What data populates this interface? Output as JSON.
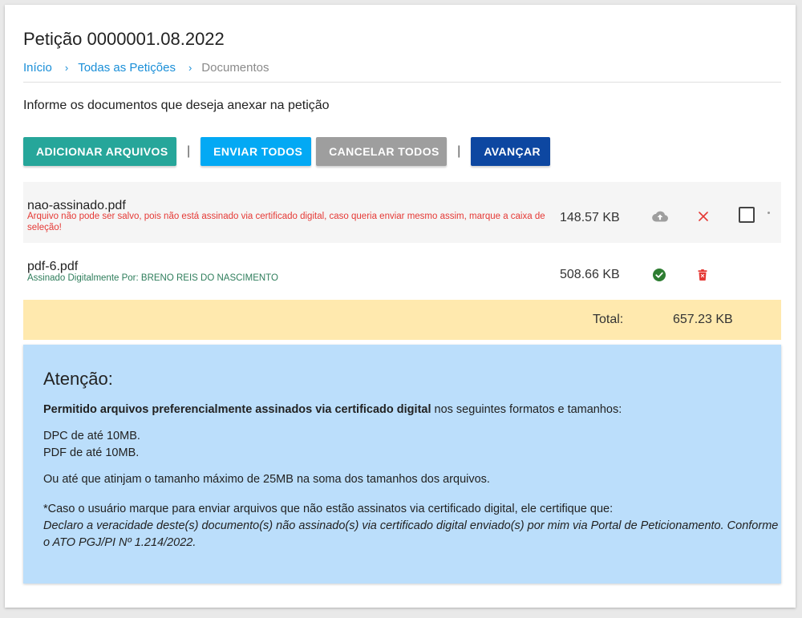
{
  "header": {
    "title": "Petição 0000001.08.2022",
    "breadcrumb": [
      {
        "label": "Início"
      },
      {
        "label": "Todas as Petições"
      },
      {
        "label": "Documentos"
      }
    ],
    "separator": "›"
  },
  "instructions": "Informe os documentos que deseja anexar na petição",
  "toolbar": {
    "add_label": "Adicionar arquivos",
    "send_all_label": "Enviar todos",
    "cancel_all_label": "Cancelar todos",
    "next_label": "Avançar",
    "divider": "|"
  },
  "files": [
    {
      "name": "nao-assinado.pdf",
      "message": "Arquivo não pode ser salvo, pois não está assinado via certificado digital, caso queria enviar mesmo assim, marque a caixa de seleção!",
      "size": "148.57 KB",
      "status_icon": "cloud-upload-icon",
      "action_icon": "close-icon",
      "checkbox_checked": false
    },
    {
      "name": "pdf-6.pdf",
      "message": "Assinado Digitalmente Por: BRENO REIS DO NASCIMENTO",
      "size": "508.66 KB",
      "status_icon": "check-circle-icon",
      "action_icon": "trash-icon"
    }
  ],
  "total": {
    "label": "Total:",
    "value": "657.23 KB"
  },
  "notice": {
    "title": "Atenção:",
    "intro_bold": "Permitido arquivos preferencialmente assinados via certificado digital",
    "intro_rest": " nos seguintes formatos e tamanhos:",
    "formats": [
      "DPC de até 10MB.",
      "PDF de até 10MB."
    ],
    "max_total": "Ou até que atinjam o tamanho máximo de 25MB na soma dos tamanhos dos arquivos.",
    "disclaimer": "*Caso o usuário marque para enviar arquivos que não estão assinatos via certificado digital, ele certifique que:",
    "declaration": "Declaro a veracidade deste(s) documento(s) não assinado(s) via certificado digital enviado(s) por mim via Portal de Peticionamento. Conforme o ATO PGJ/PI Nº 1.214/2022."
  },
  "colors": {
    "teal": "#26a69a",
    "light_blue": "#03a9f4",
    "grey": "#9e9e9e",
    "navy": "#0d47a1",
    "error_red": "#e53935",
    "success_green": "#2e7d32",
    "total_bar": "#ffe9ae",
    "notice_bg": "#bbdefb"
  }
}
